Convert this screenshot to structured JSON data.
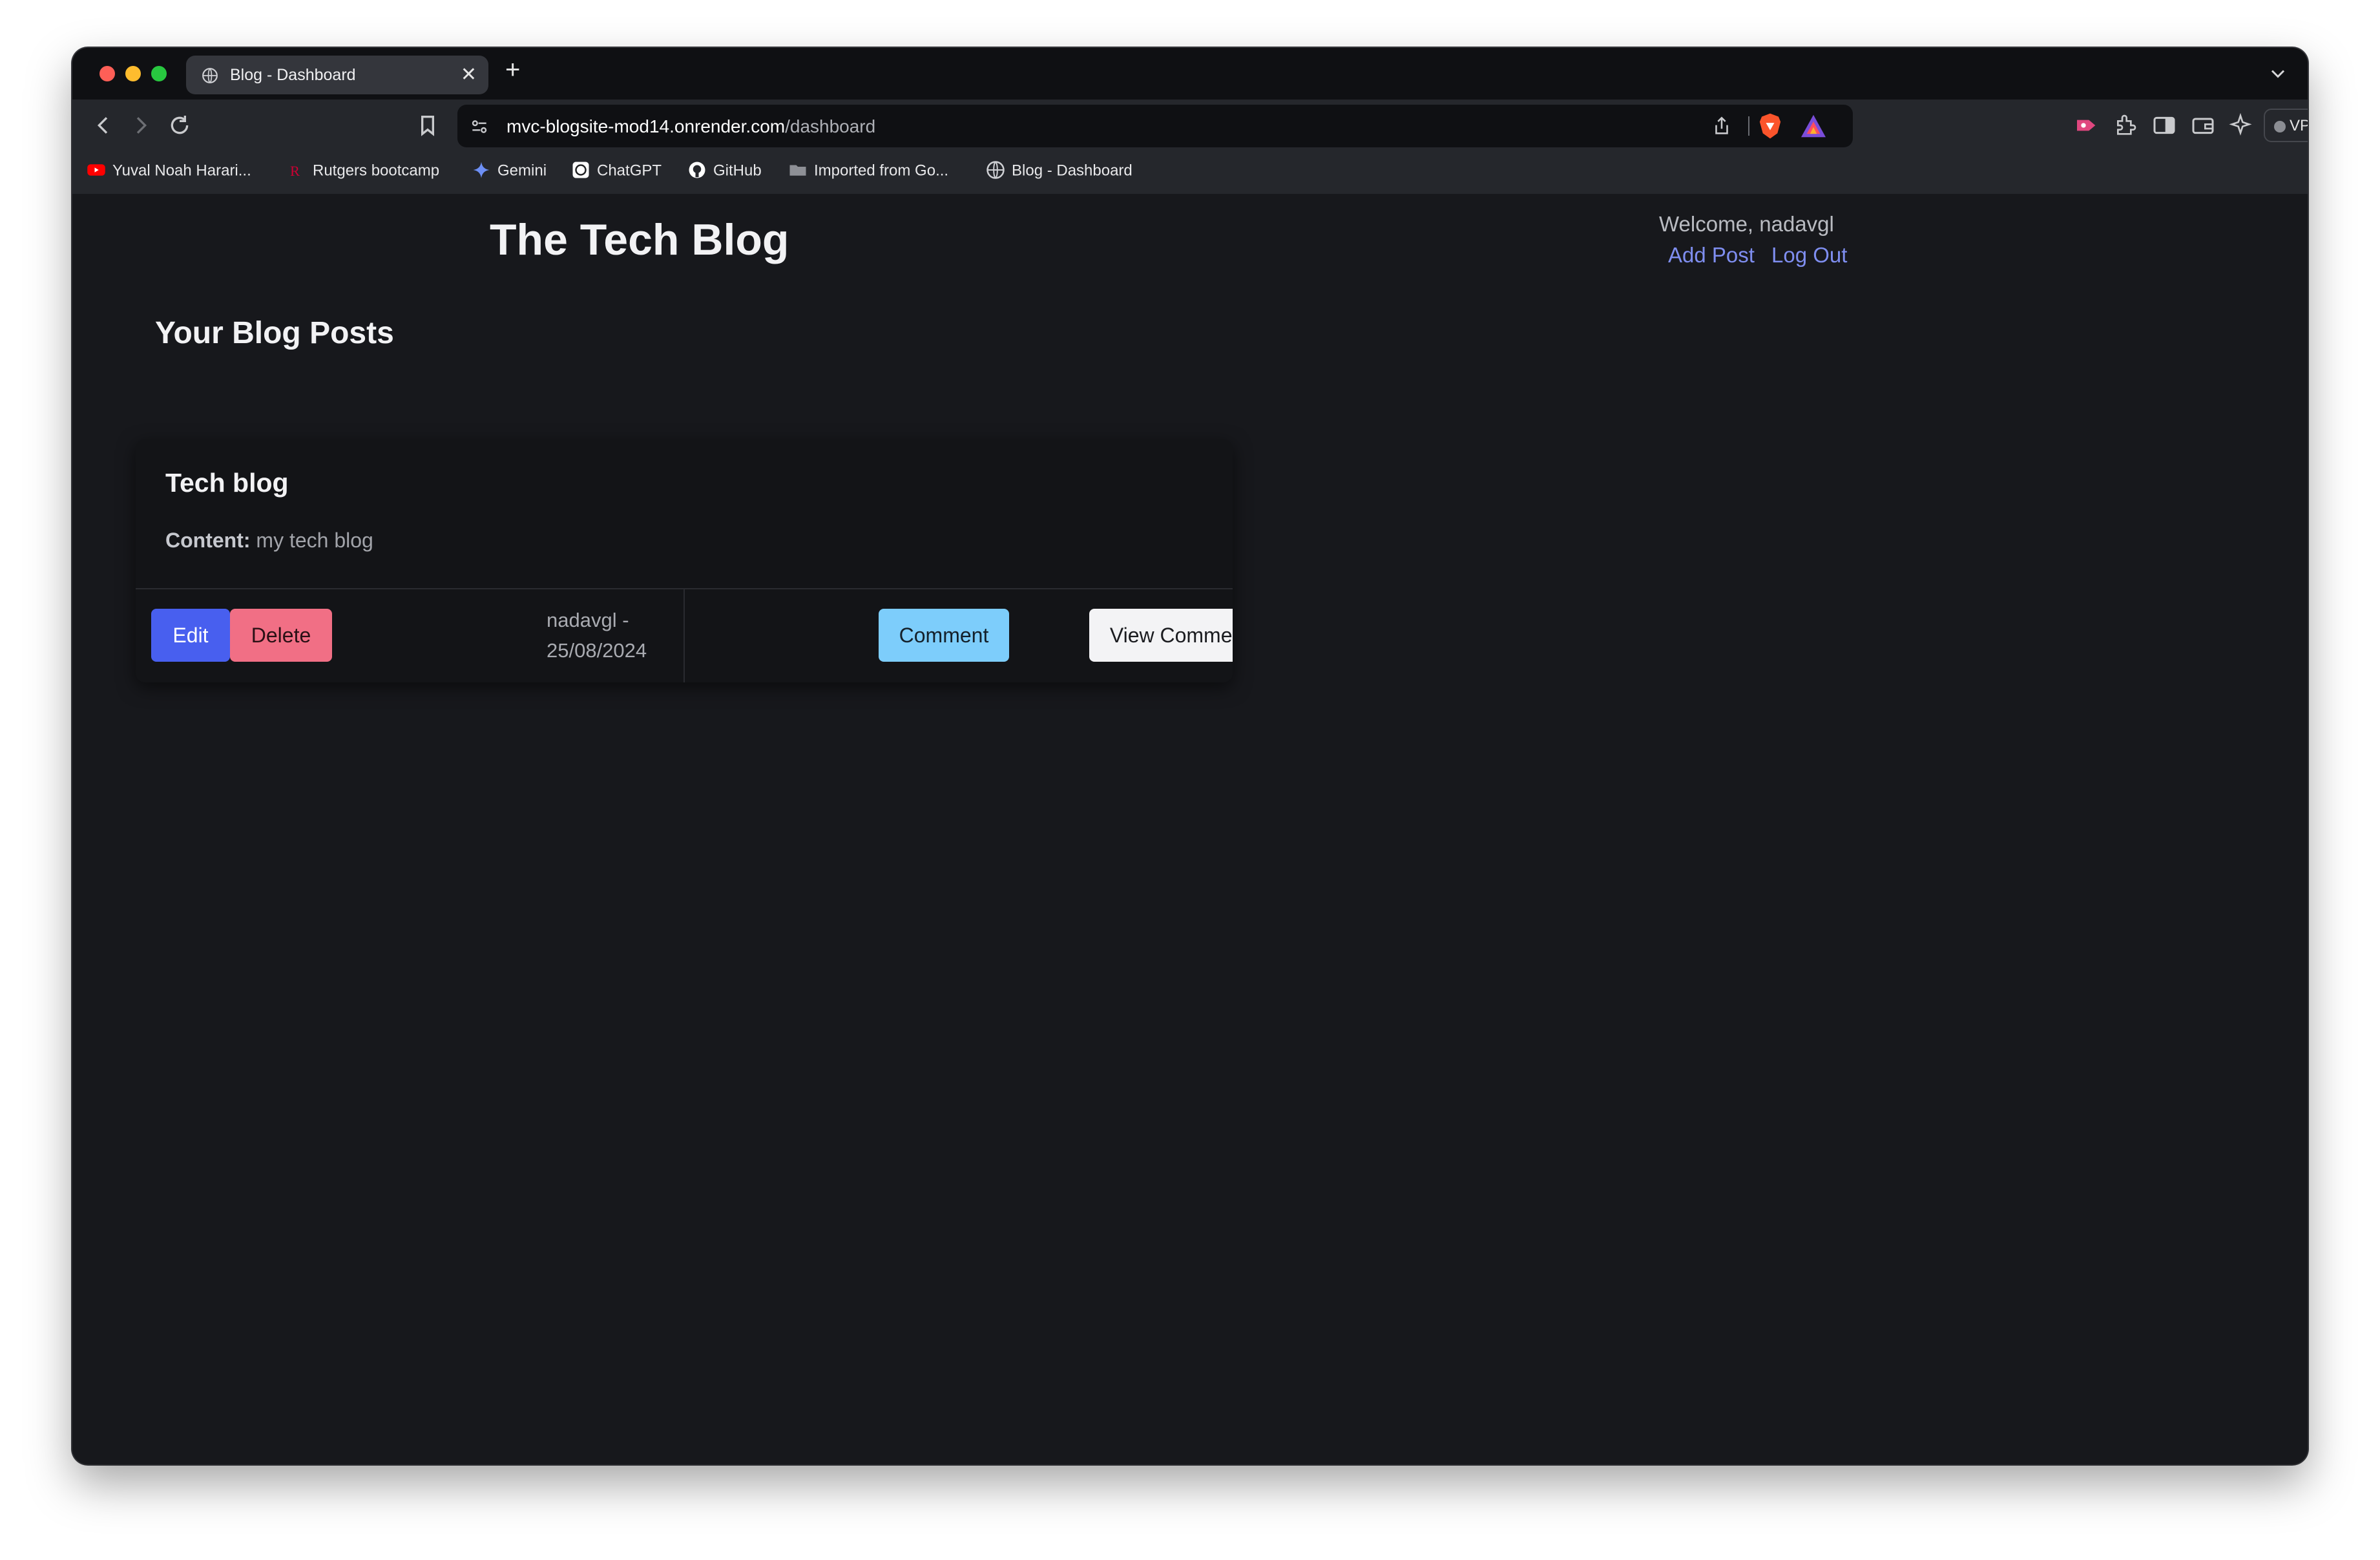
{
  "browser": {
    "tab": {
      "title": "Blog - Dashboard",
      "close": "✕"
    },
    "new_tab": "+",
    "url": {
      "host": "mvc-blogsite-mod14.onrender.com",
      "path": "/dashboard"
    },
    "vpn_label": "VPN",
    "bookmarks": [
      {
        "label": "Yuval Noah Harari...",
        "icon": "youtube-icon"
      },
      {
        "label": "Rutgers bootcamp",
        "icon": "rutgers-icon"
      },
      {
        "label": "Gemini",
        "icon": "gemini-icon"
      },
      {
        "label": "ChatGPT",
        "icon": "chatgpt-icon"
      },
      {
        "label": "GitHub",
        "icon": "github-icon"
      },
      {
        "label": "Imported from Go...",
        "icon": "folder-icon"
      },
      {
        "label": "Blog - Dashboard",
        "icon": "globe-icon"
      }
    ]
  },
  "site": {
    "title": "The Tech Blog",
    "welcome": "Welcome, nadavgl",
    "nav": {
      "add_post": "Add Post",
      "log_out": "Log Out"
    }
  },
  "main": {
    "section_title": "Your Blog Posts",
    "posts": [
      {
        "title": "Tech blog",
        "content_label": "Content:",
        "content": "my tech blog",
        "author": "nadavgl -",
        "date": "25/08/2024",
        "edit_label": "Edit",
        "delete_label": "Delete",
        "comment_label": "Comment",
        "view_comments_label": "View Comments"
      }
    ]
  },
  "colors": {
    "page_bg": "#17181c",
    "link": "#7f8ef0",
    "edit": "#485fef",
    "delete": "#f16f85",
    "comment": "#7dcdfb",
    "view_comments": "#f3f3f5"
  }
}
